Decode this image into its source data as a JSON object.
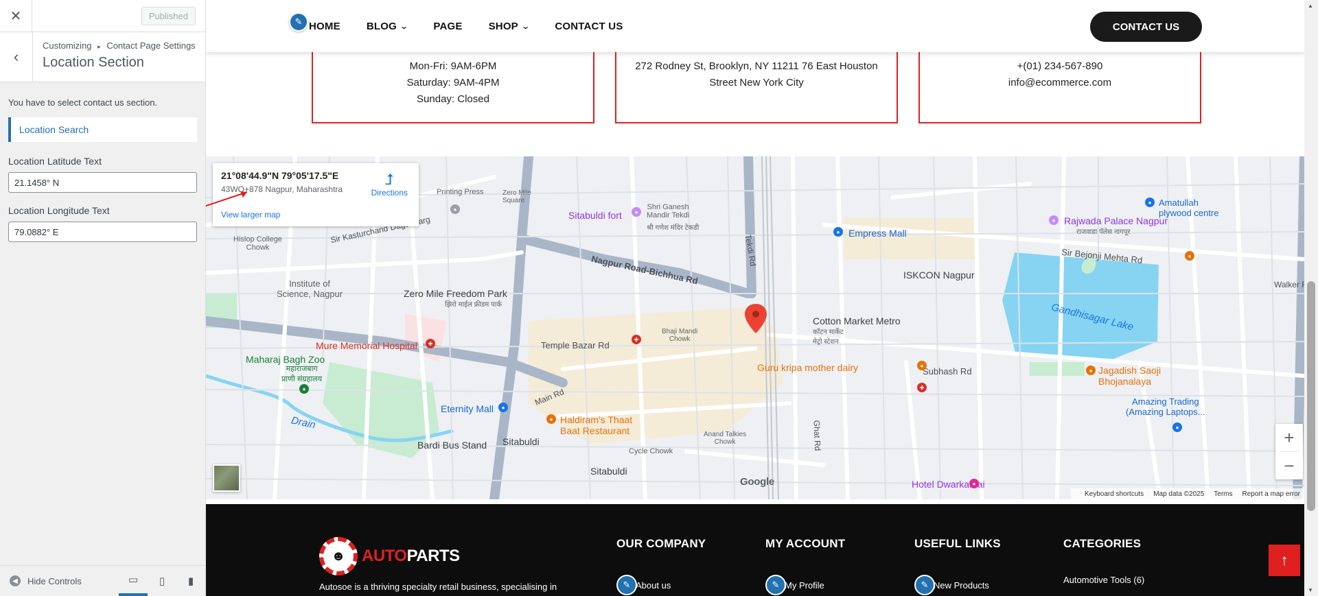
{
  "customizer": {
    "close_icon": "close-icon",
    "published_label": "Published",
    "breadcrumb_root": "Customizing",
    "breadcrumb_separator": "▸",
    "breadcrumb_parent": "Contact Page Settings",
    "section_title": "Location Section",
    "note": "You have to select contact us section.",
    "location_search_heading": "Location Search",
    "latitude_label": "Location Latitude Text",
    "latitude_value": "21.1458° N",
    "longitude_label": "Location Longitude Text",
    "longitude_value": "79.0882° E",
    "hide_controls_label": "Hide Controls"
  },
  "header": {
    "nav": [
      {
        "label": "HOME",
        "has_dropdown": false
      },
      {
        "label": "BLOG",
        "has_dropdown": true
      },
      {
        "label": "PAGE",
        "has_dropdown": false
      },
      {
        "label": "SHOP",
        "has_dropdown": true
      },
      {
        "label": "CONTACT US",
        "has_dropdown": false
      }
    ],
    "cta_label": "CONTACT US"
  },
  "info_cards": [
    {
      "lines": [
        "Mon-Fri: 9AM-6PM",
        "Saturday: 9AM-4PM",
        "Sunday: Closed"
      ]
    },
    {
      "lines": [
        "272 Rodney St, Brooklyn, NY 11211 76 East Houston",
        "Street New York City"
      ]
    },
    {
      "lines": [
        "+(01) 234-567-890",
        "info@ecommerce.com"
      ]
    }
  ],
  "map": {
    "coords": "21°08'44.9\"N 79°05'17.5\"E",
    "address": "43WQ+878 Nagpur, Maharashtra",
    "directions_label": "Directions",
    "larger_map_label": "View larger map",
    "google_label": "Google",
    "attribution": [
      "Keyboard shortcuts",
      "Map data ©2025",
      "Terms",
      "Report a map error"
    ],
    "labels": {
      "printing_press": "Printing Press",
      "zero_mile_square": "Zero Mile\nSquare",
      "sitabuldi_fort": "Sitabuldi fort",
      "shri_ganesh": "Shri Ganesh\nMandir Tekdi",
      "shri_ganesh_hi": "श्री गणेश मंदिर टेकडी",
      "tekdi_rd": "Tekdi Rd",
      "hislop": "Hislop College\nChowk",
      "kasturchand": "Sir Kasturchand Daga Marg",
      "institute": "Institute of\nScience, Nagpur",
      "zero_mile_park": "Zero Mile Freedom Park",
      "zero_mile_park_hi": "झिरो माईल फ्रीडम पार्क",
      "nagpur_road": "Nagpur Road-Bichhua Rd",
      "mure": "Mure Memorial Hospital",
      "temple_bazar": "Temple Bazar Rd",
      "maharaj_bagh": "Maharaj Bagh Zoo",
      "maharaj_bagh_hi": "महाराजबाग\nप्राणी संग्रहालय",
      "eternity": "Eternity Mall",
      "main_rd": "Main Rd",
      "drain": "Drain",
      "bardi": "Bardi Bus Stand",
      "haldiram": "Haldiram's Thaat\nBaat Restaurant",
      "sitabuldi": "Sitabuldi",
      "sitabuldi_station": "Sitabuldi",
      "empress": "Empress Mall",
      "iskcon": "ISKCON Nagpur",
      "cotton": "Cotton Market Metro",
      "cotton_hi": "कॉटन मार्केट\nमेट्रो स्टेशन",
      "guru_kripa": "Guru kripa mother dairy",
      "subhash": "Subhash Rd",
      "gandhisagar": "Gandhisagar Lake",
      "rajwada": "Rajwada Palace Nagpur",
      "rajwada_hi": "राजवाडा पॅलेस नागपूर",
      "amatullah": "Amatullah\nplywood centre",
      "bejonji": "Sir Bejonji Mehta Rd",
      "jagadish": "Jagadish Saoji\nBhojanalaya",
      "amazing": "Amazing Trading\n(Amazing Laptops...",
      "dwarkamai": "Hotel Dwarkamai",
      "bhaji_mandi": "Bhaji Mandi\nChowk",
      "anand": "Anand Talkies\nChowk",
      "cycle": "Cycle Chowk",
      "ghat_rd": "Ghat Rd",
      "walker": "Walker R"
    }
  },
  "footer": {
    "brand_a": "AUTO",
    "brand_b": "PARTS",
    "description": "Autosoe is a thriving specialty retail business, specialising in",
    "columns": [
      {
        "heading": "OUR COMPANY",
        "first_link": "About us"
      },
      {
        "heading": "MY ACCOUNT",
        "first_link": "My Profile"
      },
      {
        "heading": "USEFUL LINKS",
        "first_link": "New Products"
      },
      {
        "heading": "CATEGORIES",
        "first_link": "Automotive Tools (6)"
      }
    ],
    "to_top_icon": "arrow-up-icon"
  },
  "colors": {
    "accent": "#e02020",
    "wp_blue": "#2271b1",
    "dark": "#1a1a1a"
  }
}
